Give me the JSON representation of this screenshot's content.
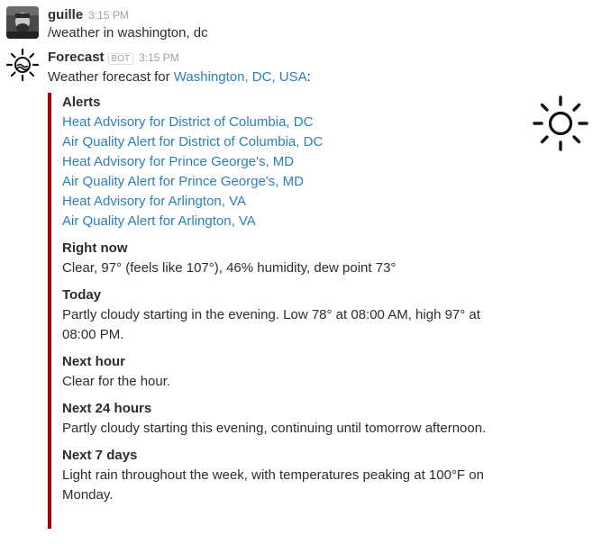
{
  "messages": [
    {
      "author": "guille",
      "time": "3:15 PM",
      "text": "/weather in washington, dc"
    },
    {
      "author": "Forecast",
      "badge": "BOT",
      "time": "3:15 PM",
      "intro_prefix": "Weather forecast for ",
      "location_link": "Washington, DC, USA",
      "intro_suffix": ":"
    }
  ],
  "attachment": {
    "accent_color": "#a50000",
    "icon": "sun-icon",
    "alerts_title": "Alerts",
    "alerts": [
      "Heat Advisory for District of Columbia, DC",
      "Air Quality Alert for District of Columbia, DC",
      "Heat Advisory for Prince George's, MD",
      "Air Quality Alert for Prince George's, MD",
      "Heat Advisory for Arlington, VA",
      "Air Quality Alert for Arlington, VA"
    ],
    "sections": [
      {
        "title": "Right now",
        "text": "Clear, 97° (feels like 107°), 46% humidity, dew point 73°"
      },
      {
        "title": "Today",
        "text": "Partly cloudy starting in the evening. Low 78° at 08:00 AM, high 97° at 08:00 PM."
      },
      {
        "title": "Next hour",
        "text": "Clear for the hour."
      },
      {
        "title": "Next 24 hours",
        "text": "Partly cloudy starting this evening, continuing until tomorrow afternoon."
      },
      {
        "title": "Next 7 days",
        "text": "Light rain throughout the week, with temperatures peaking at 100°F on Monday."
      }
    ]
  }
}
